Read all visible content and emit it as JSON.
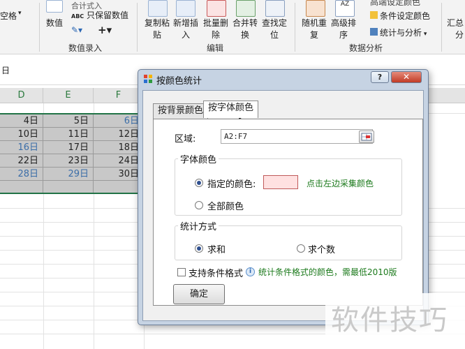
{
  "ribbon": {
    "left_partial": "空格",
    "numeric": "数值",
    "gather_sum": "合计式入",
    "keep_numbers": "只保留数值",
    "copy_paste": [
      "复制粘",
      "贴"
    ],
    "add_insert": [
      "新增插",
      "入"
    ],
    "batch_delete": [
      "批量删",
      "除"
    ],
    "merge_convert": [
      "合并转",
      "换"
    ],
    "find_locate": [
      "查找定",
      "位"
    ],
    "random_repeat": [
      "随机重",
      "复"
    ],
    "advanced_sort": [
      "高级排",
      "序"
    ],
    "conditional_set_color": "条件设定颜色",
    "stats_analysis": "统计与分析",
    "highlight_repeat": "高端设定颜色",
    "summary_partial": [
      "汇总",
      "分"
    ],
    "groups": {
      "value_entry": "数值录入",
      "edit": "编辑",
      "data_analysis": "数据分析"
    }
  },
  "formula_bar": {
    "cell_text": "日"
  },
  "sheet": {
    "columns": [
      "D",
      "E",
      "F"
    ],
    "rows": [
      [
        "4日",
        "5日",
        "6日"
      ],
      [
        "10日",
        "11日",
        "12日"
      ],
      [
        "16日",
        "17日",
        "18日"
      ],
      [
        "22日",
        "23日",
        "24日"
      ],
      [
        "28日",
        "29日",
        "30日"
      ]
    ]
  },
  "dialog": {
    "title": "按颜色统计",
    "help": "?",
    "close": "✕",
    "tabs": [
      "按背景颜色",
      "按字体颜色"
    ],
    "range_label": "区域:",
    "range_value": "A2:F7",
    "font_color_group": "字体颜色",
    "specified_color": "指定的颜色:",
    "pick_hint": "点击左边采集颜色",
    "all_colors": "全部颜色",
    "stat_mode_group": "统计方式",
    "sum": "求和",
    "count": "求个数",
    "support_conditional": "支持条件格式",
    "conditional_hint": "统计条件格式的颜色，需最低2010版",
    "ok": "确定",
    "swatch_color": "#ffe1e1"
  },
  "watermark": "软件技巧"
}
